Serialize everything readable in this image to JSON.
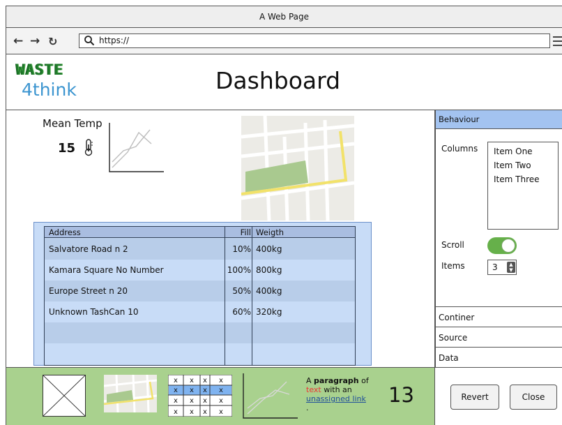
{
  "window": {
    "title": "A Web Page"
  },
  "browser": {
    "url": "https://"
  },
  "header": {
    "logo_top": "WASTE",
    "logo_bottom": "4think",
    "title": "Dashboard"
  },
  "stats": {
    "label": "Mean Temp",
    "value": "15"
  },
  "table": {
    "headers": [
      "Address",
      "Fill",
      "Weigth"
    ],
    "rows": [
      [
        "Salvatore Road n 2",
        "10%",
        "400kg"
      ],
      [
        "Kamara Square  No Number",
        "100%",
        "800kg"
      ],
      [
        "Europe Street n 20",
        "50%",
        "400kg"
      ],
      [
        "Unknown TashCan 10",
        "60%",
        "320kg"
      ]
    ]
  },
  "side": {
    "section_title": "Behaviour",
    "columns_label": "Columns",
    "columns": [
      "Item One",
      "Item Two",
      "Item Three"
    ],
    "scroll_label": "Scroll",
    "scroll_on": true,
    "items_label": "Items",
    "items_value": "3",
    "accordion": [
      "Continer",
      "Source",
      "Data"
    ]
  },
  "footer": {
    "table_cells": [
      [
        "x",
        "x",
        "x",
        "x"
      ],
      [
        "x",
        "x",
        "x",
        "x"
      ],
      [
        "x",
        "x",
        "x",
        "x"
      ],
      [
        "x",
        "x",
        "x",
        "x"
      ]
    ],
    "para_a": "A ",
    "para_bold": "paragraph",
    "para_b": " of ",
    "para_red": "text",
    "para_c": " with an ",
    "para_link": "unassigned link",
    "para_end": ".",
    "number": "13",
    "revert": "Revert",
    "close": "Close"
  },
  "colors": {
    "accent_blue": "#a3c3f0",
    "toggle_green": "#66b04a",
    "footer_green": "#a9d18e",
    "table_bg": "#c8dcf7"
  }
}
